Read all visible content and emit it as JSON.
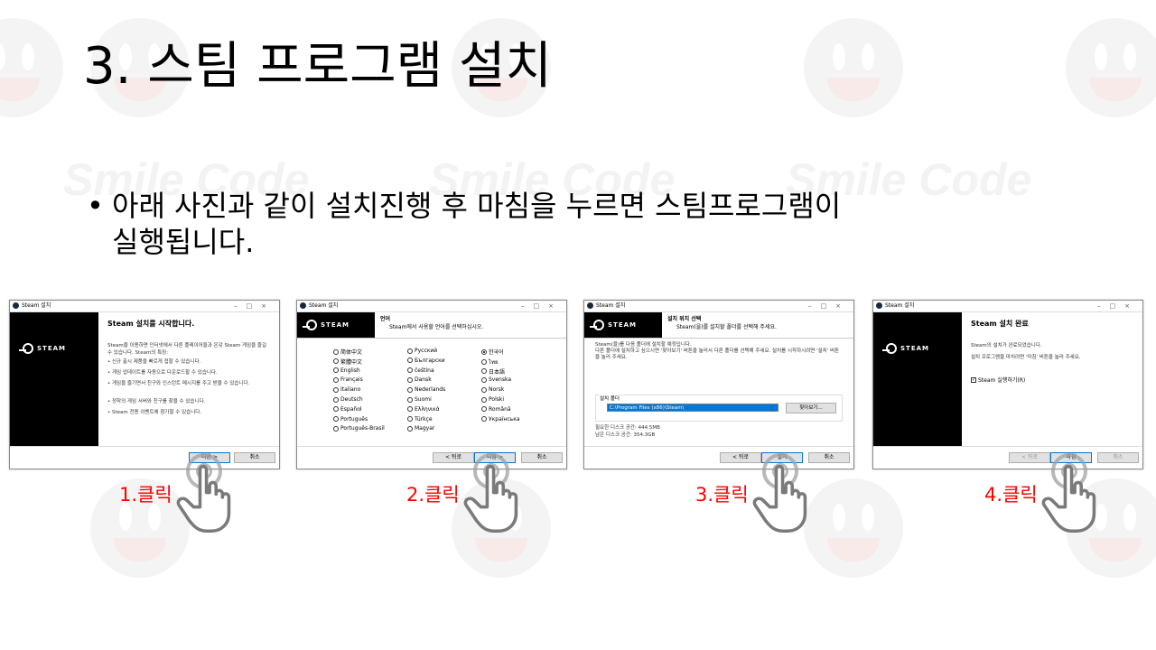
{
  "slide": {
    "title": "3. 스팀 프로그램 설치",
    "bullet_marker": "•",
    "bullet_line1": "아래 사진과 같이 설치진행 후 마침을 누르면 스팀프로그램이",
    "bullet_line2": "실행됩니다."
  },
  "watermark": {
    "text": "Smile Code"
  },
  "window_title": "Steam 설치",
  "window_controls": "–□×",
  "steam_logo_text": "STEAM",
  "screen1": {
    "title": "Steam 설치를 시작합니다.",
    "intro": "Steam을 이용하면 인터넷에서 다른 플레이어들과 온갖 Steam 게임을 즐길 수 있습니다. Steam의 특징:",
    "features": [
      "• 신규 출시 제품을 빠르게 접할 수 있습니다.",
      "• 게임 업데이트를 자동으로 다운로드할 수 있습니다.",
      "• 게임을 즐기면서 친구와 인스턴트 메시지를 주고 받을 수 있습니다.",
      "• 정학의 게임 서버와 친구를 찾을 수 있습니다.",
      "• Steam 전용 이벤트에 참가할 수 있습니다."
    ],
    "next": "다음 >",
    "cancel": "취소"
  },
  "screen2": {
    "header_title": "언어",
    "header_sub": "Steam에서 사용할 언어를 선택하십시오.",
    "col1": [
      "简体中文",
      "繁體中文",
      "English",
      "Français",
      "Italiano",
      "Deutsch",
      "Español",
      "Português",
      "Português-Brasil"
    ],
    "col2": [
      "Русский",
      "Български",
      "čeština",
      "Dansk",
      "Nederlands",
      "Suomi",
      "Ελληνικά",
      "Türkçe",
      "Magyar"
    ],
    "col3": [
      "한국어",
      "ไทย",
      "日本語",
      "Svenska",
      "Norsk",
      "Polski",
      "Română",
      "Українська"
    ],
    "selected": "한국어",
    "back": "< 뒤로",
    "next": "다음 >",
    "cancel": "취소"
  },
  "screen3": {
    "header_title": "설치 위치 선택",
    "header_sub": "Steam(을)를 설치할 폴더를 선택해 주세요.",
    "desc1": "Steam(을)를 다음 폴더에 설치할 예정입니다.",
    "desc2": "다른 폴더에 설치하고 싶으시면 '찾아보기' 버튼을 눌러서 다른 폴더를 선택해 주세요. 설치를 시작하시려면 '설치' 버튼을 눌러 주세요.",
    "group_label": "설치 폴더",
    "path": "C:\\Program Files (x86)\\Steam\\",
    "browse": "찾아보기...",
    "required": "필요한 디스크 공간: 444.5MB",
    "available": "남은 디스크 공간: 354.3GB",
    "back": "< 뒤로",
    "install": "설치",
    "cancel": "취소"
  },
  "screen4": {
    "title": "Steam 설치 완료",
    "line1": "Steam의 설치가 완료되었습니다.",
    "line2": "설치 프로그램을 마치려면 '마침' 버튼을 눌러 주세요.",
    "checkbox": "Steam 실행하기(R)",
    "back": "< 뒤로",
    "finish": "마침",
    "cancel": "취소"
  },
  "clicks": [
    "1.클릭",
    "2.클릭",
    "3.클릭",
    "4.클릭"
  ],
  "colors": {
    "click_label": "#ff0000",
    "steam_side": "#000000",
    "focus": "#0078d7"
  }
}
